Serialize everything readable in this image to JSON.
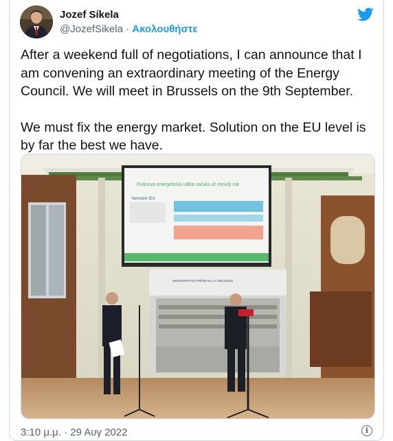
{
  "author": {
    "name": "Jozef Síkela",
    "handle": "@JozefSikela",
    "follow_label": "Ακολουθήστε",
    "separator": "·"
  },
  "tweet": {
    "paragraphs": [
      "After a weekend full of negotiations, I can announce that I am convening an extraordinary meeting of the Energy Council. We will meet in Brussels on the 9th September.",
      "We must fix the energy market. Solution on the EU level is by far the best we have."
    ]
  },
  "photo": {
    "slide_title": "Putinova energetická válka začala už minulý rok",
    "slide_subheading": "Varování IEA",
    "backdrop_text": "MINISTERSTVO PRŮMYSLU A OBCHODU"
  },
  "timestamp": "3:10 μ.μ. · 29 Αυγ 2022",
  "icons": {
    "brand": "twitter-bird-icon",
    "info": "info-icon"
  },
  "colors": {
    "accent": "#1d9bf0",
    "secondary_text": "#536471"
  }
}
